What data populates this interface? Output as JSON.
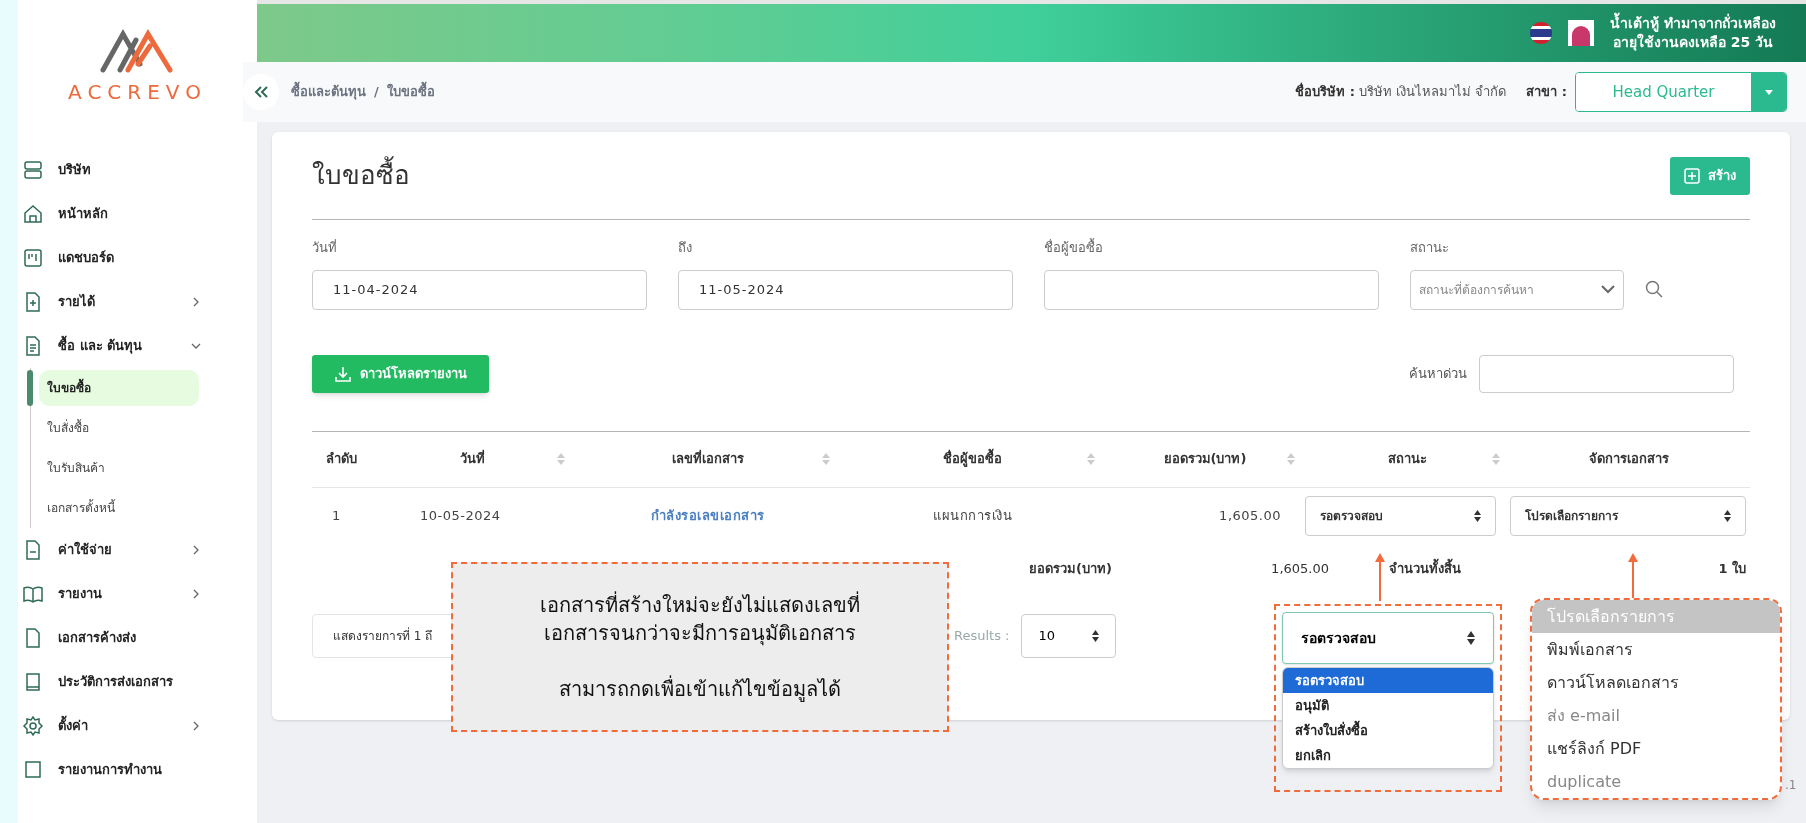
{
  "logo": {
    "text": "ACCREVO"
  },
  "sidebar": {
    "items": [
      {
        "label": "บริษัท",
        "expandable": false
      },
      {
        "label": "หน้าหลัก",
        "expandable": false
      },
      {
        "label": "แดชบอร์ด",
        "expandable": false
      },
      {
        "label": "รายได้",
        "expandable": true,
        "expanded": false
      },
      {
        "label": "ซื้อ และ ต้นทุน",
        "expandable": true,
        "expanded": true,
        "children": [
          {
            "label": "ใบขอซื้อ",
            "selected": true
          },
          {
            "label": "ใบสั่งซื้อ",
            "selected": false
          },
          {
            "label": "ใบรับสินค้า",
            "selected": false
          },
          {
            "label": "เอกสารตั้งหนี้",
            "selected": false
          }
        ]
      },
      {
        "label": "ค่าใช้จ่าย",
        "expandable": true,
        "expanded": false
      },
      {
        "label": "รายงาน",
        "expandable": true,
        "expanded": false
      },
      {
        "label": "เอกสารค้างส่ง",
        "expandable": false
      },
      {
        "label": "ประวัติการส่งเอกสาร",
        "expandable": false
      },
      {
        "label": "ตั้งค่า",
        "expandable": true,
        "expanded": false
      },
      {
        "label": "รายงานการทำงาน",
        "expandable": false
      }
    ]
  },
  "header": {
    "user_name": "น้ำเต้าหู้ ทำมาจากถั่วเหลือง",
    "subscription": "อายุใช้งานคงเหลือ 25 วัน"
  },
  "breadcrumb": {
    "items": [
      "ซื้อและต้นทุน",
      "ใบขอซื้อ"
    ],
    "separator": "/"
  },
  "company": {
    "label": "ชื่อบริษัท :",
    "value": "บริษัท เงินไหลมาไม่ จำกัด"
  },
  "branch": {
    "label": "สาขา :",
    "value": "Head Quarter"
  },
  "page": {
    "title": "ใบขอซื้อ",
    "create_button": "สร้าง"
  },
  "filters": [
    {
      "kind": "input",
      "label": "วันที่",
      "value": "11-04-2024"
    },
    {
      "kind": "input",
      "label": "ถึง",
      "value": "11-05-2024"
    },
    {
      "kind": "input",
      "label": "ชื่อผู้ขอซื้อ"
    },
    {
      "kind": "select",
      "label": "สถานะ",
      "placeholder": "สถานะที่ต้องการค้นหา"
    }
  ],
  "download_button": "ดาวน์โหลดรายงาน",
  "quick_search": {
    "label": "ค้นหาด่วน"
  },
  "table": {
    "columns": [
      {
        "label": "ลำดับ",
        "sortable": false
      },
      {
        "label": "วันที่",
        "sortable": true
      },
      {
        "label": "เลขที่เอกสาร",
        "sortable": true
      },
      {
        "label": "ชื่อผู้ขอซื้อ",
        "sortable": true
      },
      {
        "label": "ยอดรวม(บาท)",
        "sortable": true
      },
      {
        "label": "สถานะ",
        "sortable": true
      },
      {
        "label": "จัดการเอกสาร",
        "sortable": false
      }
    ],
    "rows": [
      {
        "cells": [
          "1",
          "10-05-2024",
          "กำลังรอเลขเอกสาร",
          "แผนกการเงิน",
          "1,605.00"
        ],
        "status": "รอตรวจสอบ",
        "action": "โปรดเลือกรายการ"
      }
    ],
    "footer": {
      "total_label": "ยอดรวม(บาท)",
      "total": "1,605.00",
      "count_label": "จำนวนทั้งสิ้น",
      "count": "1 ใบ"
    }
  },
  "pagination": {
    "info": "แสดงรายการที่ 1 ถึ",
    "results_label": "Results :",
    "page_size": "10"
  },
  "version": ".1",
  "note": {
    "lines": [
      "เอกสารที่สร้างใหม่จะยังไม่แสดงเลขที่",
      "เอกสารจนกว่าจะมีการอนุมัติเอกสาร",
      "สามารถกดเพื่อเข้าแก้ไขข้อมูลได้"
    ]
  },
  "status_dropdown": {
    "value": "รอตรวจสอบ",
    "options": [
      {
        "label": "รอตรวจสอบ",
        "selected": true
      },
      {
        "label": "อนุมัติ",
        "selected": false
      },
      {
        "label": "สร้างใบสั่งซื้อ",
        "selected": false
      },
      {
        "label": "ยกเลิก",
        "selected": false
      }
    ]
  },
  "action_menu": {
    "options": [
      {
        "label": "โปรดเลือกรายการ",
        "selected": true,
        "disabled": false
      },
      {
        "label": "พิมพ์เอกสาร",
        "selected": false,
        "disabled": false
      },
      {
        "label": "ดาวน์โหลดเอกสาร",
        "selected": false,
        "disabled": false
      },
      {
        "label": "ส่ง e-mail",
        "selected": false,
        "disabled": true
      },
      {
        "label": "แชร์ลิงก์ PDF",
        "selected": false,
        "disabled": false
      },
      {
        "label": "duplicate",
        "selected": false,
        "disabled": true
      }
    ]
  }
}
